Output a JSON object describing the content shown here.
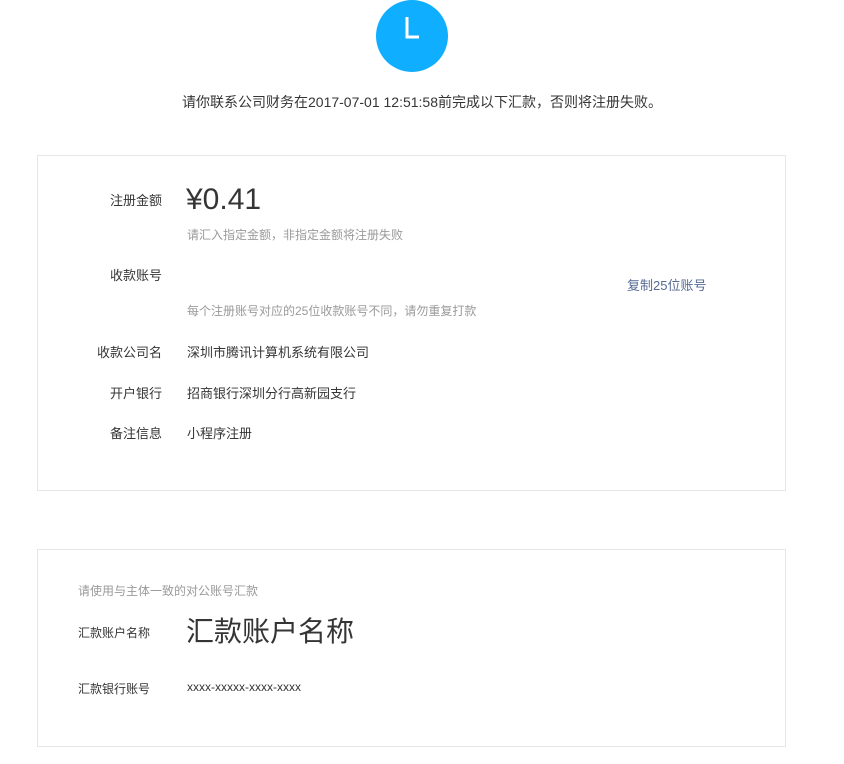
{
  "status": {
    "icon": "clock-icon",
    "icon_color": "#10aeff"
  },
  "notice": "请你联系公司财务在2017-07-01 12:51:58前完成以下汇款，否则将注册失败。",
  "payment": {
    "amount_label": "注册金额",
    "amount": "¥0.41",
    "amount_hint": "请汇入指定金额，非指定金额将注册失败",
    "account_label": "收款账号",
    "account_value": "",
    "copy_link": "复制25位账号",
    "account_hint": "每个注册账号对应的25位收款账号不同，请勿重复打款",
    "company_label": "收款公司名",
    "company_value": "深圳市腾讯计算机系统有限公司",
    "bank_label": "开户银行",
    "bank_value": "招商银行深圳分行高新园支行",
    "remark_label": "备注信息",
    "remark_value": "小程序注册"
  },
  "remitter": {
    "hint": "请使用与主体一致的对公账号汇款",
    "name_label": "汇款账户名称",
    "name_value": "汇款账户名称",
    "account_label": "汇款银行账号",
    "account_value": "xxxx-xxxxx-xxxx-xxxx"
  },
  "colors": {
    "accent": "#10aeff",
    "link": "#576b95",
    "hint_text": "#9a9a9a",
    "border": "#e7e7eb"
  }
}
